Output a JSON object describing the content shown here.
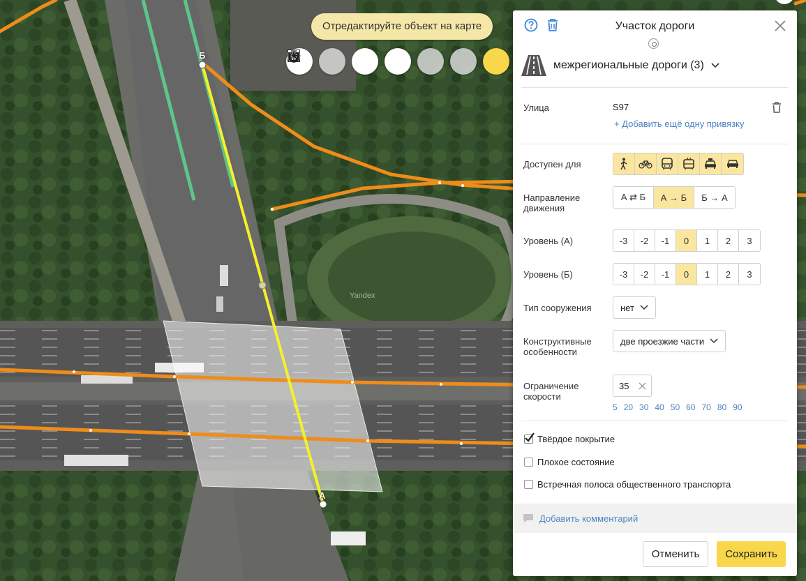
{
  "map": {
    "hint": "Отредактируйте объект на карте",
    "watermark": "Yandex",
    "point_start": "А",
    "point_end": "Б",
    "tools": [
      {
        "icon": "undo-icon",
        "state": "normal"
      },
      {
        "icon": "redo-icon",
        "state": "disabled"
      },
      {
        "icon": "delete-vertex-icon",
        "state": "normal"
      },
      {
        "icon": "move-icon",
        "state": "normal"
      },
      {
        "icon": "polygon-icon",
        "state": "disabled"
      },
      {
        "icon": "junction-icon",
        "state": "disabled"
      },
      {
        "icon": "magnet-icon",
        "state": "active"
      }
    ]
  },
  "panel": {
    "title": "Участок дороги",
    "category": "межрегиональные дороги (3)",
    "street_label": "Улица",
    "street_value": "S97",
    "add_binding": "+ Добавить ещё одну привязку",
    "access_label": "Доступен для",
    "access_icons": [
      "pedestrian-icon",
      "bicycle-icon",
      "bus-icon",
      "trolleybus-icon",
      "taxi-icon",
      "car-icon"
    ],
    "direction_label": "Направление движения",
    "direction_options": [
      "А ⇄ Б",
      "А → Б",
      "Б → А"
    ],
    "direction_selected": "А → Б",
    "level_a_label": "Уровень (А)",
    "level_b_label": "Уровень (Б)",
    "levels": [
      "-3",
      "-2",
      "-1",
      "0",
      "1",
      "2",
      "3"
    ],
    "level_a_selected": "0",
    "level_b_selected": "0",
    "structure_label": "Тип сооружения",
    "structure_value": "нет",
    "construct_label": "Конструктивные особенности",
    "construct_value": "две проезжие части",
    "speed_label": "Ограничение скорости",
    "speed_value": "35",
    "speed_presets": [
      "5",
      "20",
      "30",
      "40",
      "50",
      "60",
      "70",
      "80",
      "90"
    ],
    "checkboxes": [
      {
        "label": "Твёрдое покрытие",
        "checked": true
      },
      {
        "label": "Плохое состояние",
        "checked": false
      },
      {
        "label": "Встречная полоса общественного транспорта",
        "checked": false
      }
    ],
    "comment": "Добавить комментарий",
    "cancel": "Отменить",
    "save": "Сохранить"
  },
  "colors": {
    "road_orange": "#ef8c1a",
    "edit_line": "#f6f02a",
    "green_line": "#5ec48a",
    "accent": "#f9d74a",
    "selected": "#fbe6a0",
    "link": "#4b83c4"
  }
}
